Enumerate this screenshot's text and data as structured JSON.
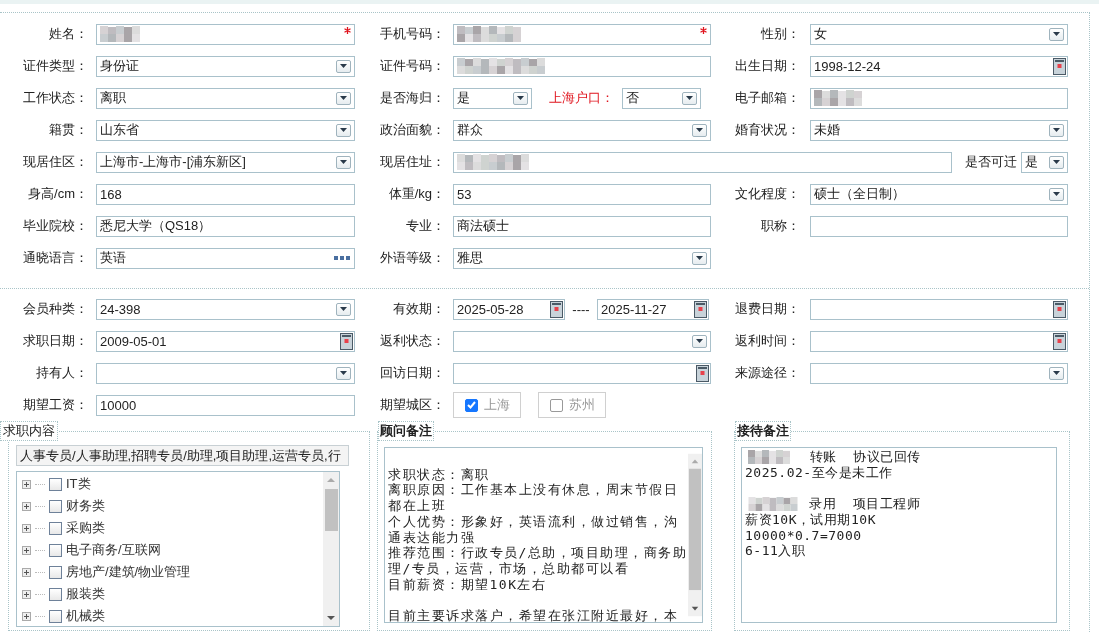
{
  "profile": {
    "rows": [
      {
        "kind": "standard",
        "groups": [
          {
            "label": "姓名：",
            "kind": "blurred",
            "required": true,
            "important": false
          },
          {
            "label": "手机号码：",
            "kind": "blurred",
            "required": true,
            "important": false
          },
          {
            "label": "性别：",
            "kind": "select",
            "value": "女",
            "required": false,
            "important": false
          }
        ]
      },
      {
        "kind": "standard",
        "groups": [
          {
            "label": "证件类型：",
            "kind": "select",
            "value": "身份证",
            "required": false,
            "important": false
          },
          {
            "label": "证件号码：",
            "kind": "blurred",
            "required": false,
            "important": false
          },
          {
            "label": "出生日期：",
            "kind": "date",
            "value": "1998-12-24",
            "required": false,
            "important": false
          }
        ]
      },
      {
        "kind": "split",
        "groups": [
          {
            "label": "工作状态：",
            "kind": "select",
            "value": "离职",
            "required": false,
            "important": false
          },
          {
            "label": "是否海归：",
            "kind": "select",
            "value": "是",
            "required": false,
            "important": false
          },
          {
            "label": "上海户口：",
            "kind": "select",
            "value": "否",
            "required": false,
            "important": true
          },
          {
            "label": "电子邮箱：",
            "kind": "blurred",
            "required": false,
            "important": false
          }
        ]
      },
      {
        "kind": "standard",
        "groups": [
          {
            "label": "籍贯：",
            "kind": "select",
            "value": "山东省",
            "required": false,
            "important": false
          },
          {
            "label": "政治面貌：",
            "kind": "select",
            "value": "群众",
            "required": false,
            "important": false
          },
          {
            "label": "婚育状况：",
            "kind": "select",
            "value": "未婚",
            "required": false,
            "important": false
          }
        ]
      },
      {
        "kind": "wide",
        "groups": [
          {
            "label": "现居住区：",
            "kind": "select",
            "value": "上海市-上海市-[浦东新区]",
            "required": false,
            "important": false
          },
          {
            "label": "现居住址：",
            "kind": "blurred",
            "required": false,
            "important": false
          },
          {
            "label": "是否可迁",
            "kind": "select",
            "value": "是",
            "required": false,
            "important": false
          }
        ]
      },
      {
        "kind": "standard",
        "groups": [
          {
            "label": "身高/cm：",
            "kind": "text",
            "value": "168",
            "required": false,
            "important": false
          },
          {
            "label": "体重/kg：",
            "kind": "text",
            "value": "53",
            "required": false,
            "important": false
          },
          {
            "label": "文化程度：",
            "kind": "select",
            "value": "硕士（全日制）",
            "required": false,
            "important": false
          }
        ]
      },
      {
        "kind": "standard",
        "groups": [
          {
            "label": "毕业院校：",
            "kind": "text",
            "value": "悉尼大学（QS18）",
            "required": false,
            "important": false
          },
          {
            "label": "专业：",
            "kind": "text",
            "value": "商法硕士",
            "required": false,
            "important": false
          },
          {
            "label": "职称：",
            "kind": "text",
            "required": false,
            "important": false
          }
        ]
      },
      {
        "kind": "standard",
        "groups": [
          {
            "label": "通晓语言：",
            "kind": "picker",
            "value": "英语",
            "required": false,
            "important": false
          },
          {
            "label": "外语等级：",
            "kind": "select",
            "value": "雅思",
            "required": false,
            "important": false
          }
        ]
      }
    ]
  },
  "membership": {
    "rows": [
      {
        "kind": "standard",
        "groups": [
          {
            "label": "会员种类：",
            "kind": "select",
            "value": "24-398",
            "required": false,
            "important": false
          },
          {
            "label": "有效期：",
            "kind": "range",
            "values": [
              "2025-05-28",
              "2025-11-27"
            ],
            "separator": "----",
            "important": false
          },
          {
            "label": "退费日期：",
            "kind": "date",
            "required": false,
            "important": false
          }
        ]
      },
      {
        "kind": "standard",
        "groups": [
          {
            "label": "求职日期：",
            "kind": "date",
            "value": "2009-05-01",
            "required": false,
            "important": false
          },
          {
            "label": "返利状态：",
            "kind": "select",
            "required": false,
            "important": false
          },
          {
            "label": "返利时间：",
            "kind": "date",
            "required": false,
            "important": false
          }
        ]
      },
      {
        "kind": "standard",
        "groups": [
          {
            "label": "持有人：",
            "kind": "select",
            "required": false,
            "important": false
          },
          {
            "label": "回访日期：",
            "kind": "date",
            "required": false,
            "important": false
          },
          {
            "label": "来源途径：",
            "kind": "select",
            "required": false,
            "important": false
          }
        ]
      },
      {
        "kind": "standard",
        "groups": [
          {
            "label": "期望工资：",
            "kind": "text",
            "value": "10000",
            "required": false,
            "important": false
          },
          {
            "label": "期望城区：",
            "kind": "checks",
            "options": [
              {
                "label": "上海",
                "checked": true
              },
              {
                "label": "苏州",
                "checked": false
              }
            ],
            "important": false
          }
        ]
      }
    ]
  },
  "job_panel": {
    "legend": "求职内容",
    "summary": "人事专员/人事助理,招聘专员/助理,项目助理,运营专员,行",
    "tree": [
      {
        "label": "IT类",
        "expanded": false,
        "checked": false
      },
      {
        "label": "财务类",
        "expanded": false,
        "checked": false
      },
      {
        "label": "采购类",
        "expanded": false,
        "checked": false
      },
      {
        "label": "电子商务/互联网",
        "expanded": false,
        "checked": false
      },
      {
        "label": "房地产/建筑/物业管理",
        "expanded": false,
        "checked": false
      },
      {
        "label": "服装类",
        "expanded": false,
        "checked": false
      },
      {
        "label": "机械类",
        "expanded": false,
        "checked": false
      }
    ]
  },
  "advisor_panel": {
    "legend": "顾问备注",
    "lines": [
      {
        "blurred": false
      },
      {
        "blurred": false,
        "text": "求职状态：离职"
      },
      {
        "blurred": false,
        "text": "离职原因：工作基本上没有休息，周末节假日都在上班"
      },
      {
        "blurred": false,
        "text": "个人优势：形象好，英语流利，做过销售，沟通表达能力强"
      },
      {
        "blurred": false,
        "text": "推荐范围：行政专员/总助，项目助理，商务助理/专员，运营，市场，总助都可以看"
      },
      {
        "blurred": false,
        "text": "目前薪资：期望10K左右"
      },
      {
        "blurred": false
      },
      {
        "blurred": false,
        "text": "目前主要诉求落户，希望在张江附近最好，本"
      }
    ]
  },
  "reception_panel": {
    "legend": "接待备注",
    "lines": [
      {
        "blurred": true,
        "text": "  转账  协议已回传"
      },
      {
        "blurred": false,
        "text": "2025.02-至今是未工作"
      },
      {
        "blurred": false
      },
      {
        "blurred": true,
        "text": " 录用  项目工程师"
      },
      {
        "blurred": false,
        "text": "薪资10K，试用期10K"
      },
      {
        "blurred": false,
        "text": "10000*0.7=7000"
      },
      {
        "blurred": false,
        "text": "6-11入职"
      }
    ]
  }
}
